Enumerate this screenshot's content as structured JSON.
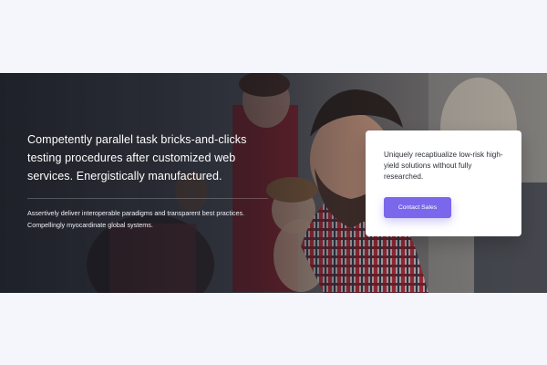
{
  "hero": {
    "title": "Competently parallel task bricks-and-clicks testing procedures after customized web services. Energistically manufactured.",
    "description": "Assertively deliver interoperable paradigms and transparent best practices. Compellingly myocardinate global systems."
  },
  "card": {
    "text": "Uniquely recaptiualize low-risk high-yield solutions without fully researched.",
    "button_label": "Contact Sales"
  },
  "colors": {
    "page_background": "#f5f6fb",
    "accent": "#7a67eb",
    "card_background": "#ffffff"
  }
}
